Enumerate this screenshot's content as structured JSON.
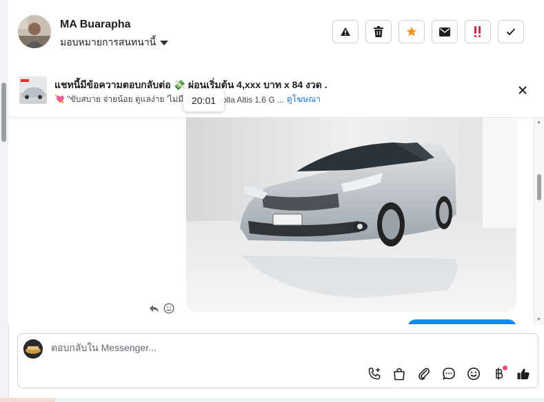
{
  "header": {
    "name": "MA Buarapha",
    "assign_label": "มอบหมายการสนทนานี้",
    "buttons": [
      {
        "name": "report-button",
        "icon": "warning-icon"
      },
      {
        "name": "delete-button",
        "icon": "trash-icon"
      },
      {
        "name": "star-button",
        "icon": "star-icon"
      },
      {
        "name": "mark-unread-button",
        "icon": "mail-icon"
      },
      {
        "name": "follow-up-button",
        "icon": "exclamation-icon"
      },
      {
        "name": "done-button",
        "icon": "check-icon"
      }
    ]
  },
  "ad": {
    "title": "แชทนี้มีข้อความตอบกลับต่อ 💸 ผ่อนเริ่มต้น 4,xxx บาท x 84 งวด .",
    "subtitle_prefix": "💘 \"ขับสบาย จ่ายน้อย ดูแลง่าย 'ไม่มีวัน",
    "car": "Corolla Altis 1.6 G ...",
    "link": "ดูโฆษณา"
  },
  "tooltip": {
    "time": "20:01"
  },
  "composer": {
    "placeholder": "ตอบกลับใน Messenger...",
    "icons": [
      "add-call-icon",
      "shopping-bag-icon",
      "attachment-icon",
      "chat-bubble-icon",
      "emoji-icon",
      "baht-icon",
      "thumbs-up-icon"
    ]
  },
  "colors": {
    "accent": "#1877f2",
    "outgoing_bubble": "#1b84f6",
    "star": "#f7931e",
    "follow_up": "#e41e3f"
  }
}
